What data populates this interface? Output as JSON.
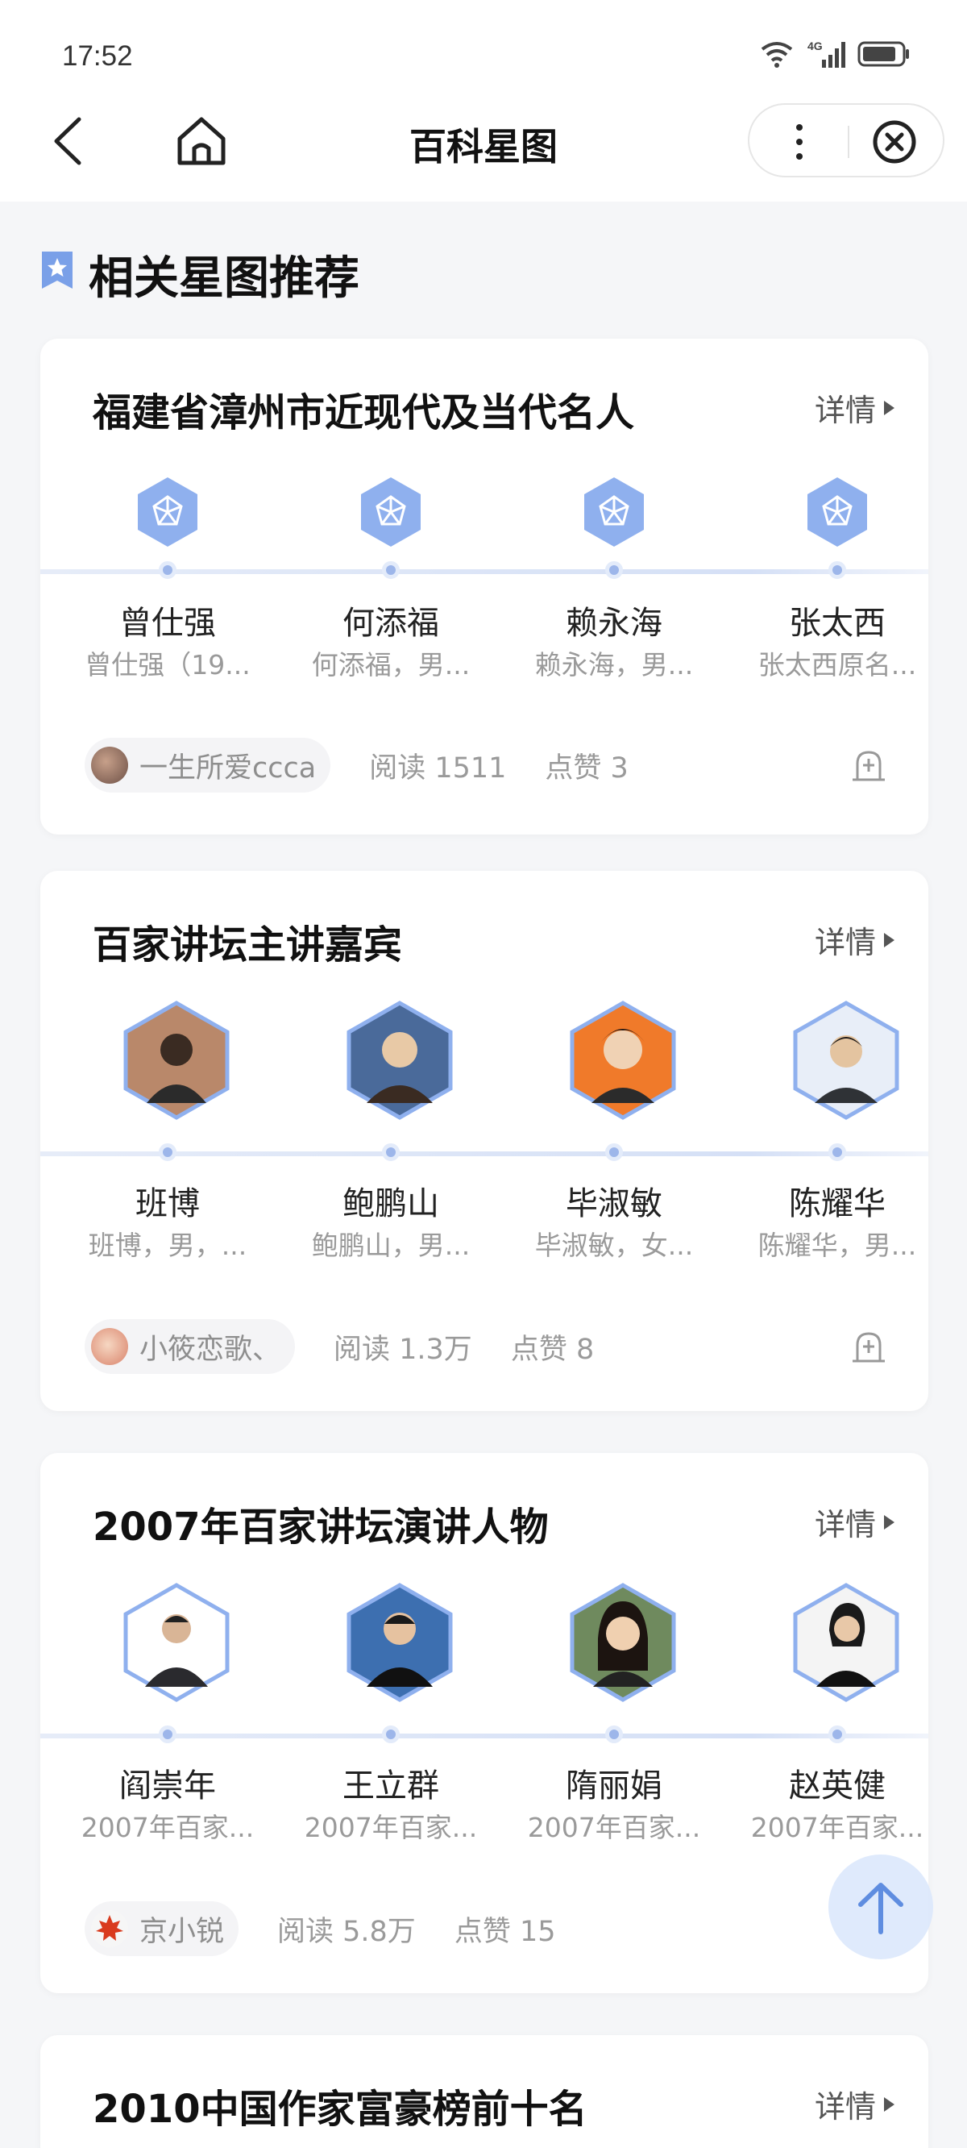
{
  "status_bar": {
    "time": "17:52",
    "network": "4G"
  },
  "nav": {
    "title": "百科星图",
    "back_icon": "chevron-left-icon",
    "home_icon": "home-icon",
    "more_icon": "more-vertical-icon",
    "close_icon": "close-circle-icon"
  },
  "section": {
    "title": "相关星图推荐",
    "icon": "star-bookmark-icon"
  },
  "cards": [
    {
      "title": "福建省漳州市近现代及当代名人",
      "detail_label": "详情",
      "people": [
        {
          "name": "曾仕强",
          "desc": "曾仕强（19..."
        },
        {
          "name": "何添福",
          "desc": "何添福，男..."
        },
        {
          "name": "赖永海",
          "desc": "赖永海，男..."
        },
        {
          "name": "张太西",
          "desc": "张太西原名..."
        }
      ],
      "author": "一生所爱ccca",
      "reads": "阅读 1511",
      "likes": "点赞 3"
    },
    {
      "title": "百家讲坛主讲嘉宾",
      "detail_label": "详情",
      "people": [
        {
          "name": "班博",
          "desc": "班博，男，..."
        },
        {
          "name": "鲍鹏山",
          "desc": "鲍鹏山，男..."
        },
        {
          "name": "毕淑敏",
          "desc": "毕淑敏，女..."
        },
        {
          "name": "陈耀华",
          "desc": "陈耀华，男..."
        }
      ],
      "author": "小筱恋歌、",
      "reads": "阅读 1.3万",
      "likes": "点赞 8"
    },
    {
      "title": "2007年百家讲坛演讲人物",
      "detail_label": "详情",
      "people": [
        {
          "name": "阎崇年",
          "desc": "2007年百家..."
        },
        {
          "name": "王立群",
          "desc": "2007年百家..."
        },
        {
          "name": "隋丽娟",
          "desc": "2007年百家..."
        },
        {
          "name": "赵英健",
          "desc": "2007年百家..."
        }
      ],
      "author": "京小锐",
      "reads": "阅读 5.8万",
      "likes": "点赞 15"
    },
    {
      "title": "2010中国作家富豪榜前十名",
      "detail_label": "详情"
    }
  ],
  "colors": {
    "accent": "#7aa0e8",
    "hex_fill": "#8fb0ee",
    "muted_text": "#9a9a9a"
  }
}
